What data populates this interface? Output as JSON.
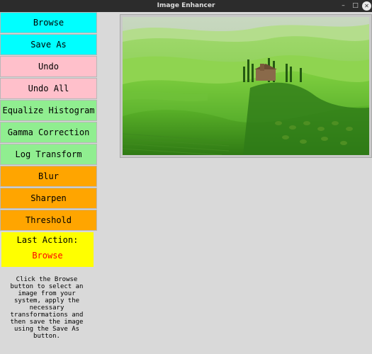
{
  "window": {
    "title": "Image Enhancer",
    "controls": {
      "minimize": "–",
      "maximize": "□",
      "close": "✕"
    }
  },
  "sidebar": {
    "buttons": [
      {
        "label": "Browse",
        "color": "#00ffff"
      },
      {
        "label": "Save As",
        "color": "#00ffff"
      },
      {
        "label": "Undo",
        "color": "#ffc0cb"
      },
      {
        "label": "Undo All",
        "color": "#ffc0cb"
      },
      {
        "label": "Equalize Histogram",
        "color": "#90ee90"
      },
      {
        "label": "Gamma Correction",
        "color": "#90ee90"
      },
      {
        "label": "Log Transform",
        "color": "#90ee90"
      },
      {
        "label": "Blur",
        "color": "#ffa500"
      },
      {
        "label": "Sharpen",
        "color": "#ffa500"
      },
      {
        "label": "Threshold",
        "color": "#ffa500"
      }
    ],
    "last_action": {
      "label": "Last Action:",
      "value": "Browse",
      "value_color": "#ff0000",
      "background": "#ffff00"
    },
    "help_text": "Click the Browse button to select an image from your system, apply the necessary transformations and then save the image using the Save As button."
  },
  "canvas": {
    "image": "landscape-photo",
    "background": "#c9c9c9"
  }
}
